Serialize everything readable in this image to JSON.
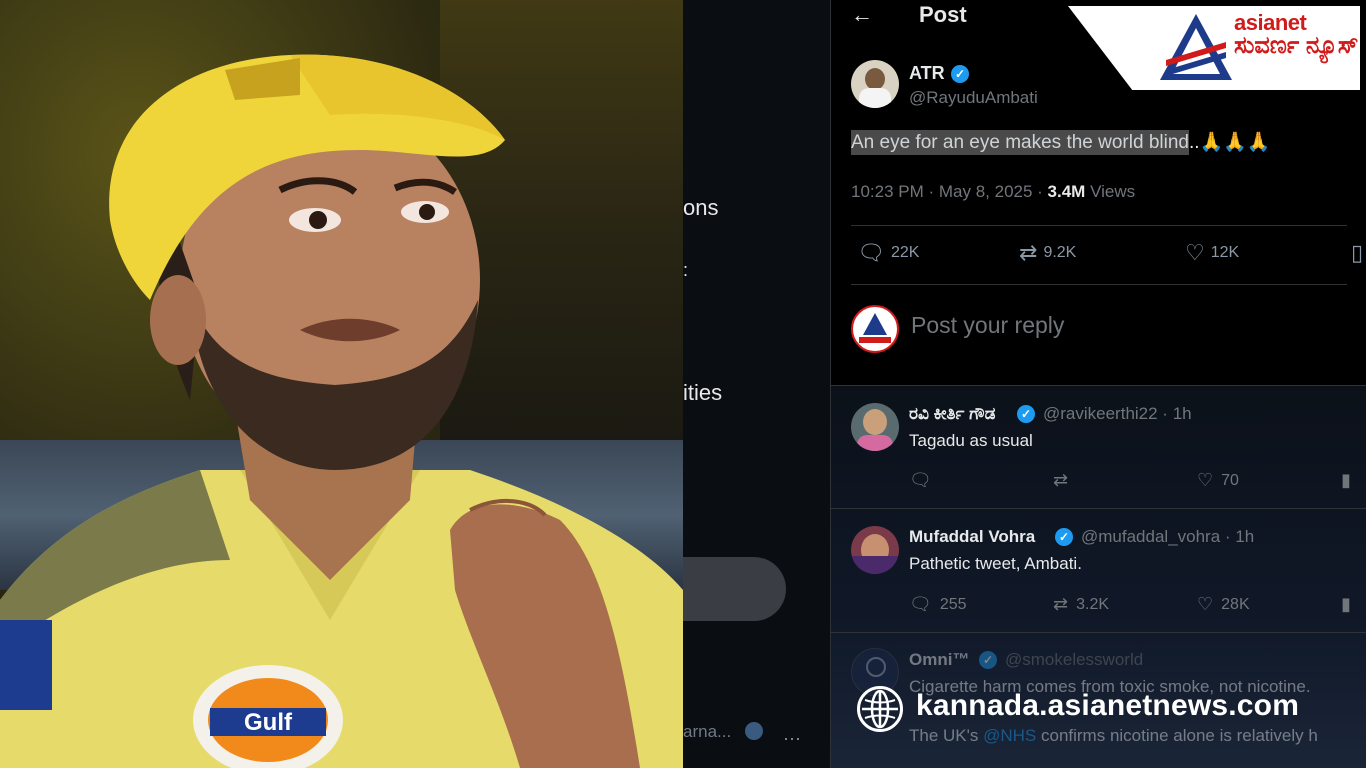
{
  "header": {
    "back_icon": "back-arrow-icon",
    "title": "Post"
  },
  "brand": {
    "word": "asianet",
    "kannada": "ಸುವರ್ಣ ನ್ಯೂಸ್",
    "logo_colors": [
      "#1e3a8a",
      "#d11a1a"
    ]
  },
  "sidebar": {
    "fragments": [
      {
        "text": "ons"
      },
      {
        "text": "ities"
      }
    ],
    "bottom_text": "arna...",
    "pill": "post-button"
  },
  "post": {
    "author_name": "ATR",
    "author_handle": "@RayuduAmbati",
    "text_highlight": "An eye for an eye makes the world blind",
    "text_rest": "..🙏🙏🙏",
    "time": "10:23 PM · May 8, 2025 · ",
    "views_count": "3.4M",
    "views_label": " Views",
    "stats": {
      "replies": "22K",
      "reposts": "9.2K",
      "likes": "12K"
    }
  },
  "reply_placeholder": "Post your reply",
  "replies": [
    {
      "name": "ರವಿ ಕೀರ್ತಿ ಗೌಡ",
      "handle": "@ravikeerthi22 · 1h",
      "text": "Tagadu as usual",
      "replies": "",
      "reposts": "",
      "likes": "70"
    },
    {
      "name": "Mufaddal Vohra",
      "handle": "@mufaddal_vohra · 1h",
      "text": "Pathetic tweet, Ambati.",
      "replies": "255",
      "reposts": "3.2K",
      "likes": "28K"
    },
    {
      "name": "Omni™",
      "handle": "@smokelessworld",
      "text": "Cigarette harm comes from toxic smoke, not nicotine.",
      "text2_a": "The UK's ",
      "text2_b": "@NHS",
      "text2_c": " confirms nicotine alone is relatively h"
    }
  ],
  "watermark": {
    "text": "kannada.asianetnews.com",
    "icon": "globe-icon"
  },
  "colors": {
    "accent": "#1d9bf0",
    "background": "#000000",
    "text": "#e7e9ea",
    "muted": "#71767b"
  }
}
